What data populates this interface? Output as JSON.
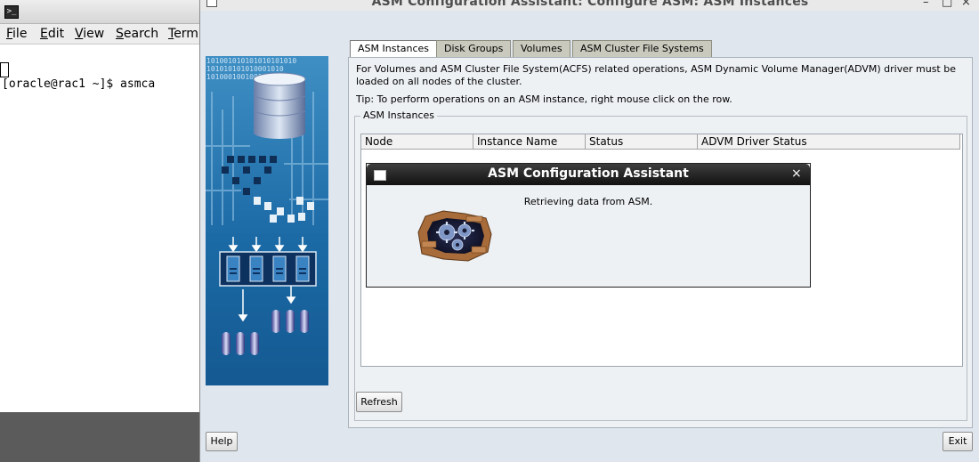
{
  "terminal": {
    "icon": "terminal-icon",
    "menu": [
      {
        "label": "File",
        "mnemonic": "F",
        "rest": "ile"
      },
      {
        "label": "Edit",
        "mnemonic": "E",
        "rest": "dit"
      },
      {
        "label": "View",
        "mnemonic": "V",
        "rest": "iew"
      },
      {
        "label": "Search",
        "mnemonic": "S",
        "rest": "earch"
      },
      {
        "label": "Term",
        "mnemonic": "T",
        "rest": "erm"
      }
    ],
    "prompt_line": "[oracle@rac1 ~]$ asmca"
  },
  "window": {
    "title": "ASM Configuration Assistant: Configure ASM: ASM Instances",
    "controls": {
      "minimize": "–",
      "maximize": "□",
      "close": "×"
    },
    "tabs": [
      {
        "label": "ASM Instances",
        "active": true
      },
      {
        "label": "Disk Groups",
        "active": false
      },
      {
        "label": "Volumes",
        "active": false
      },
      {
        "label": "ASM Cluster File Systems",
        "active": false
      }
    ],
    "info_text": "For Volumes and ASM Cluster File System(ACFS) related operations, ASM Dynamic Volume Manager(ADVM) driver must be loaded on all nodes of the cluster.",
    "tip_text": "Tip: To perform operations on an ASM instance, right mouse click on the row.",
    "group_label": "ASM Instances",
    "columns": [
      "Node",
      "Instance Name",
      "Status",
      "ADVM Driver Status"
    ],
    "refresh_label": "Refresh",
    "help_label": "Help",
    "exit_label": "Exit"
  },
  "dialog": {
    "title": "ASM Configuration Assistant",
    "close": "×",
    "message": "Retrieving data from ASM."
  },
  "side_art": {
    "binary_rows": [
      "101001010101010101010",
      "101010101010001010",
      "1010001001001010"
    ]
  },
  "colors": {
    "art_blue": "#1b6aa5",
    "art_dark": "#0d3f6c",
    "dialog_title": "#1a1a1a",
    "panel_bg": "#eef1f4"
  }
}
